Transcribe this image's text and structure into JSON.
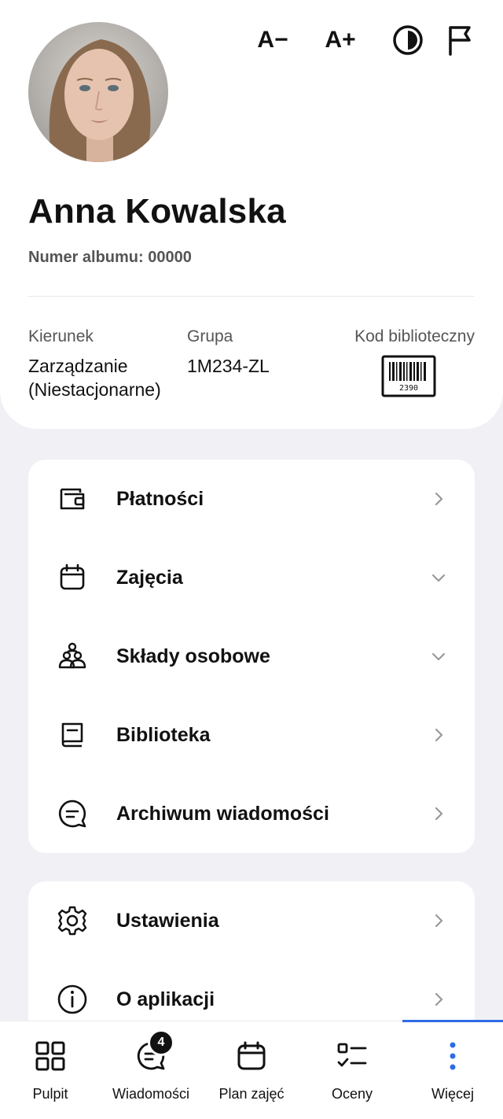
{
  "header": {
    "actions": {
      "font_decrease": "A−",
      "font_increase": "A+"
    },
    "name": "Anna Kowalska",
    "album_label": "Numer albumu:",
    "album_number": "00000",
    "kierunek_label": "Kierunek",
    "kierunek_value_line1": "Zarządzanie",
    "kierunek_value_line2": "(Niestacjonarne)",
    "grupa_label": "Grupa",
    "grupa_value": "1M234-ZL",
    "library_label": "Kod biblioteczny",
    "barcode_number": "2390"
  },
  "menu_main": {
    "items": [
      {
        "label": "Płatności",
        "icon": "wallet-icon",
        "chevron": "right"
      },
      {
        "label": "Zajęcia",
        "icon": "calendar-icon",
        "chevron": "down"
      },
      {
        "label": "Składy osobowe",
        "icon": "people-icon",
        "chevron": "down"
      },
      {
        "label": "Biblioteka",
        "icon": "book-icon",
        "chevron": "right"
      },
      {
        "label": "Archiwum wiadomości",
        "icon": "chat-archive-icon",
        "chevron": "right"
      }
    ]
  },
  "menu_secondary": {
    "items": [
      {
        "label": "Ustawienia",
        "icon": "gear-icon",
        "chevron": "right"
      },
      {
        "label": "O aplikacji",
        "icon": "info-icon",
        "chevron": "right"
      }
    ]
  },
  "bottom_nav": {
    "items": [
      {
        "label": "Pulpit",
        "icon": "grid-icon"
      },
      {
        "label": "Wiadomości",
        "icon": "chat-icon",
        "badge": "4"
      },
      {
        "label": "Plan zajęć",
        "icon": "calendar-icon"
      },
      {
        "label": "Oceny",
        "icon": "checklist-icon"
      },
      {
        "label": "Więcej",
        "icon": "more-vertical-icon",
        "active": true
      }
    ]
  },
  "colors": {
    "accent": "#2e6be6",
    "background": "#f0f0f5",
    "card": "#ffffff"
  }
}
